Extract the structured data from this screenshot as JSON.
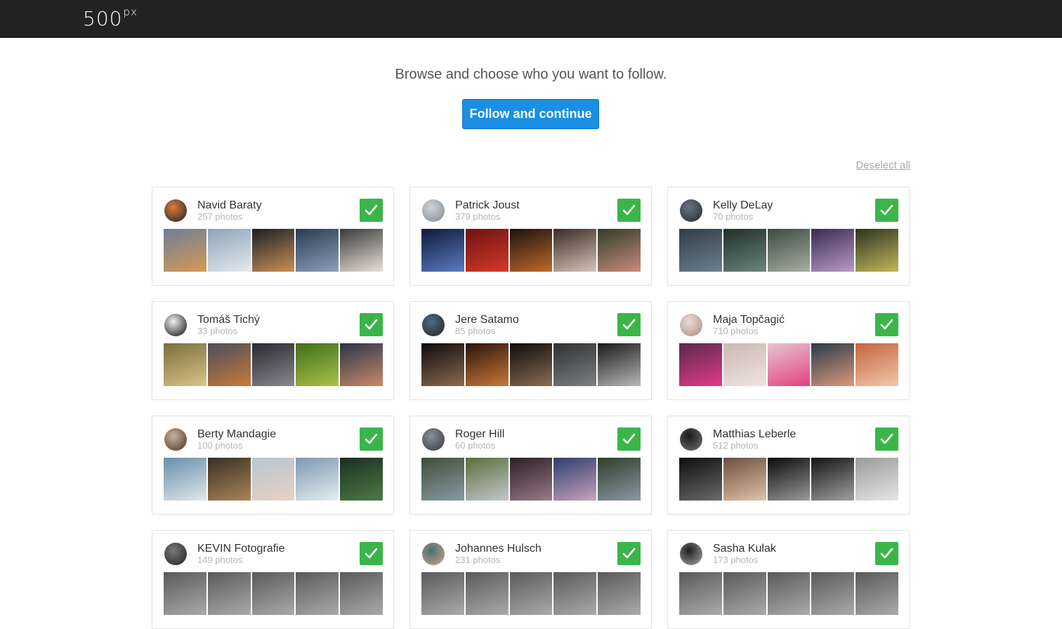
{
  "brand": {
    "logo_main": "500",
    "logo_sup": "px"
  },
  "headline": "Browse and choose who you want to follow.",
  "follow_button": "Follow and continue",
  "deselect_all": "Deselect all",
  "accent": "#1a8fe3",
  "check_color": "#3bb54a",
  "photographers": [
    {
      "name": "Navid Baraty",
      "photos": "257 photos",
      "avatar": [
        "#e07a3a",
        "#2b2b2b"
      ],
      "thumbs": [
        [
          "#6e7f96",
          "#d49a55"
        ],
        [
          "#8ea3b8",
          "#e4e9ee"
        ],
        [
          "#1b1f26",
          "#c79256"
        ],
        [
          "#2a3a52",
          "#8da0b7"
        ],
        [
          "#3a3a3a",
          "#e9e2d8"
        ]
      ]
    },
    {
      "name": "Patrick Joust",
      "photos": "379 photos",
      "avatar": [
        "#cfd4da",
        "#8a8f96"
      ],
      "thumbs": [
        [
          "#0d1a3a",
          "#5b7bc2"
        ],
        [
          "#6e1212",
          "#d23a2a"
        ],
        [
          "#1a120e",
          "#c06a2a"
        ],
        [
          "#3a2a24",
          "#d9c5b8"
        ],
        [
          "#2f3e2a",
          "#c98a7a"
        ]
      ]
    },
    {
      "name": "Kelly DeLay",
      "photos": "70 photos",
      "avatar": [
        "#6a7480",
        "#2b3038"
      ],
      "thumbs": [
        [
          "#2f3d48",
          "#6c7f8e"
        ],
        [
          "#1e2f2a",
          "#6b857c"
        ],
        [
          "#3d4a3f",
          "#a6b0a2"
        ],
        [
          "#3a2a4e",
          "#b89ac9"
        ],
        [
          "#2c3422",
          "#c2b75a"
        ]
      ]
    },
    {
      "name": "Tomáš Tichý",
      "photos": "33 photos",
      "avatar": [
        "#f2f2f2",
        "#1f1f1f"
      ],
      "thumbs": [
        [
          "#7a6e3a",
          "#d8c58a"
        ],
        [
          "#4a4e5e",
          "#c87a3a"
        ],
        [
          "#2a2a2e",
          "#8a8890"
        ],
        [
          "#3f6e1a",
          "#a9c24a"
        ],
        [
          "#2a3448",
          "#c98a6a"
        ]
      ]
    },
    {
      "name": "Jere Satamo",
      "photos": "85 photos",
      "avatar": [
        "#4f6b86",
        "#2a2a2a"
      ],
      "thumbs": [
        [
          "#0e0b0a",
          "#8a6a52"
        ],
        [
          "#2a140c",
          "#c9783a"
        ],
        [
          "#0e0c0b",
          "#8a6d55"
        ],
        [
          "#2f3032",
          "#7d7f82"
        ],
        [
          "#1a1a1a",
          "#b8b8b8"
        ]
      ]
    },
    {
      "name": "Maja Topčagić",
      "photos": "710 photos",
      "avatar": [
        "#e9dcd5",
        "#b39586"
      ],
      "thumbs": [
        [
          "#5a2a4a",
          "#e03c8a"
        ],
        [
          "#cbb8b2",
          "#f0e4df"
        ],
        [
          "#e6c6d2",
          "#e2417e"
        ],
        [
          "#2a3a4a",
          "#d99a7a"
        ],
        [
          "#c6643c",
          "#f0c7ae"
        ]
      ]
    },
    {
      "name": "Berty Mandagie",
      "photos": "100 photos",
      "avatar": [
        "#c9b29a",
        "#5a4030"
      ],
      "thumbs": [
        [
          "#6a8ea8",
          "#dfe7ec"
        ],
        [
          "#3a2e22",
          "#a9855a"
        ],
        [
          "#b8c6d2",
          "#e6d2c2"
        ],
        [
          "#7c98b0",
          "#e4edf2"
        ],
        [
          "#1a2e1e",
          "#4f7a4a"
        ]
      ]
    },
    {
      "name": "Roger Hill",
      "photos": "60 photos",
      "avatar": [
        "#8a8f96",
        "#3e4248"
      ],
      "thumbs": [
        [
          "#3e4e3a",
          "#8a9aa2"
        ],
        [
          "#5a6e3a",
          "#c2c8ce"
        ],
        [
          "#2a1e26",
          "#9a7a8a"
        ],
        [
          "#2a3e6e",
          "#c9a2ba"
        ],
        [
          "#2e3e2a",
          "#8a98a2"
        ]
      ]
    },
    {
      "name": "Matthias Leberle",
      "photos": "512 photos",
      "avatar": [
        "#1a1a1a",
        "#6a6a6a"
      ],
      "thumbs": [
        [
          "#0e0e0e",
          "#6a6a6a"
        ],
        [
          "#6a5040",
          "#e2c2a8"
        ],
        [
          "#0a0a0a",
          "#9a9a9a"
        ],
        [
          "#141414",
          "#a0a0a0"
        ],
        [
          "#9a9a9a",
          "#e6e6e6"
        ]
      ]
    },
    {
      "name": "KEVIN Fotografie",
      "photos": "149 photos",
      "avatar": [
        "#7a7a7a",
        "#2a2a2a"
      ],
      "thumbs": [
        [
          "#5a5a5a",
          "#aaaaaa"
        ],
        [
          "#5a5a5a",
          "#aaaaaa"
        ],
        [
          "#5a5a5a",
          "#aaaaaa"
        ],
        [
          "#5a5a5a",
          "#aaaaaa"
        ],
        [
          "#5a5a5a",
          "#aaaaaa"
        ]
      ]
    },
    {
      "name": "Johannes Hulsch",
      "photos": "231 photos",
      "avatar": [
        "#4a6e72",
        "#c0a08a"
      ],
      "thumbs": [
        [
          "#5a5a5a",
          "#aaaaaa"
        ],
        [
          "#5a5a5a",
          "#aaaaaa"
        ],
        [
          "#5a5a5a",
          "#aaaaaa"
        ],
        [
          "#5a5a5a",
          "#aaaaaa"
        ],
        [
          "#5a5a5a",
          "#aaaaaa"
        ]
      ]
    },
    {
      "name": "Sasha Kulak",
      "photos": "173 photos",
      "avatar": [
        "#1e1e1e",
        "#9a9a9a"
      ],
      "thumbs": [
        [
          "#5a5a5a",
          "#aaaaaa"
        ],
        [
          "#5a5a5a",
          "#aaaaaa"
        ],
        [
          "#5a5a5a",
          "#aaaaaa"
        ],
        [
          "#5a5a5a",
          "#aaaaaa"
        ],
        [
          "#5a5a5a",
          "#aaaaaa"
        ]
      ]
    }
  ]
}
